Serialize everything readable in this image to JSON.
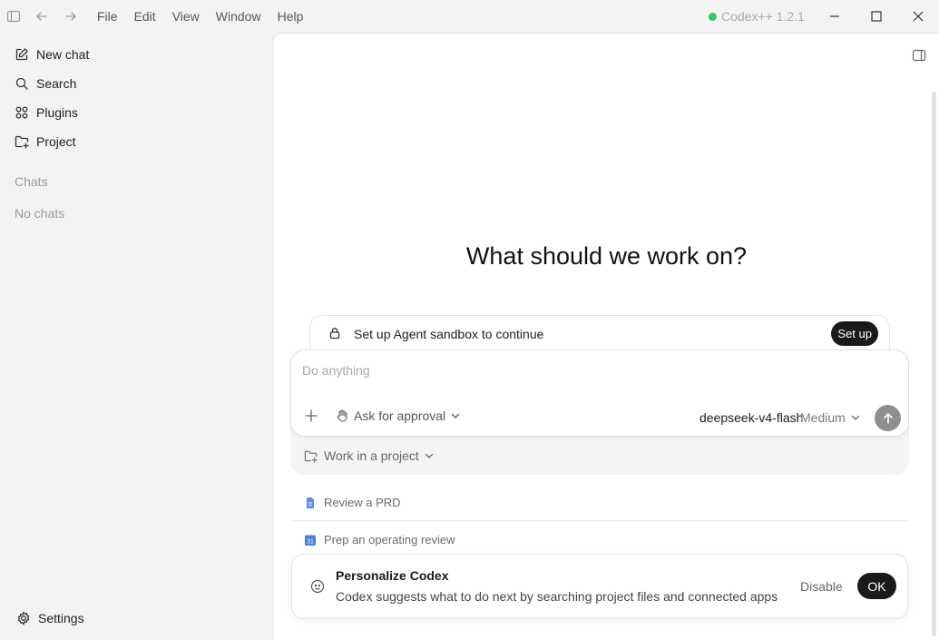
{
  "titlebar": {
    "menu": [
      "File",
      "Edit",
      "View",
      "Window",
      "Help"
    ],
    "version": "Codex++ 1.2.1",
    "status_color": "#35c46a"
  },
  "sidebar": {
    "items": [
      {
        "label": "New chat",
        "icon": "new-chat-icon"
      },
      {
        "label": "Search",
        "icon": "search-icon"
      },
      {
        "label": "Plugins",
        "icon": "plugins-icon"
      },
      {
        "label": "Project",
        "icon": "folder-plus-icon"
      }
    ],
    "chats_label": "Chats",
    "empty_label": "No chats",
    "settings_label": "Settings"
  },
  "main": {
    "headline": "What should we work on?",
    "sandbox": {
      "text": "Set up Agent sandbox to continue",
      "button": "Set up"
    },
    "composer": {
      "placeholder": "Do anything",
      "approval": "Ask for approval",
      "model": "deepseek-v4-flash",
      "effort": "Medium"
    },
    "project_label": "Work in a project",
    "suggestions": [
      {
        "label": "Review a PRD",
        "icon": "document-icon"
      },
      {
        "label": "Prep an operating review",
        "icon": "calendar-icon"
      }
    ],
    "personalize": {
      "title": "Personalize Codex",
      "description": "Codex suggests what to do next by searching project files and connected apps",
      "disable": "Disable",
      "ok": "OK"
    }
  }
}
